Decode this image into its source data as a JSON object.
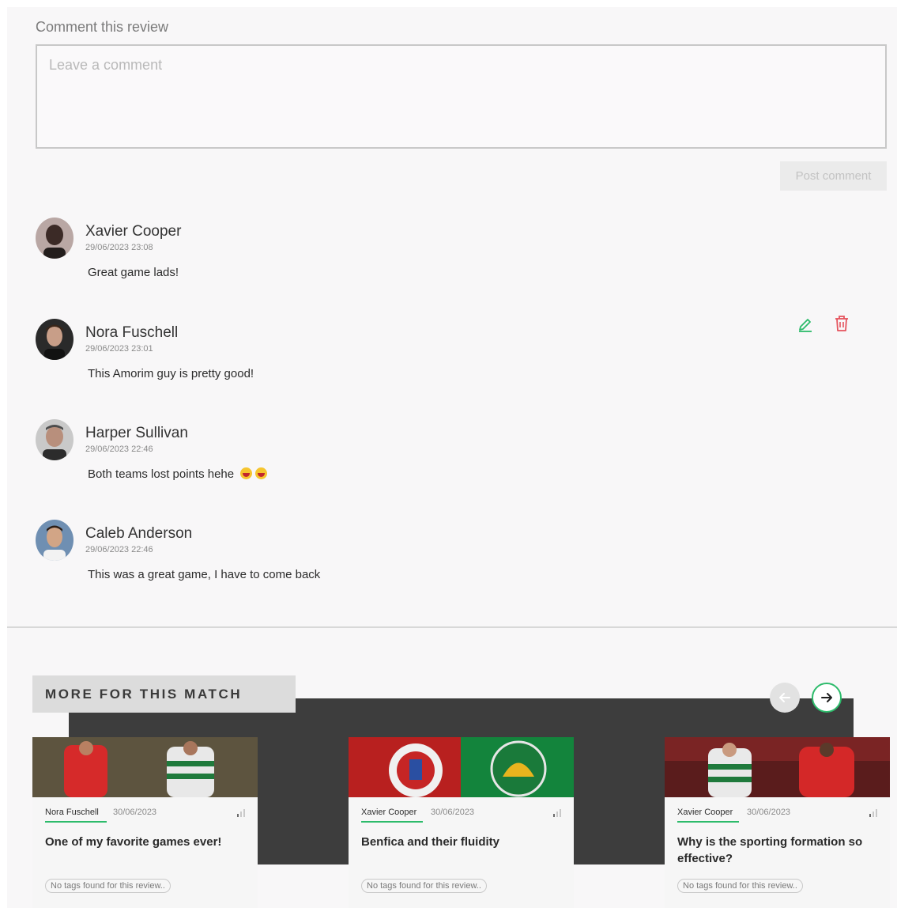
{
  "comment_form": {
    "heading": "Comment this review",
    "placeholder": "Leave a comment",
    "post_label": "Post comment"
  },
  "comments": [
    {
      "name": "Xavier Cooper",
      "date": "29/06/2023 23:08",
      "text": "Great game lads!"
    },
    {
      "name": "Nora Fuschell",
      "date": "29/06/2023 23:01",
      "text": "This Amorim guy is pretty good!"
    },
    {
      "name": "Harper Sullivan",
      "date": "29/06/2023 22:46",
      "text": "Both teams lost points hehe"
    },
    {
      "name": "Caleb Anderson",
      "date": "29/06/2023 22:46",
      "text": "This was a great game, I have to come back"
    }
  ],
  "more": {
    "title": "MORE FOR THIS MATCH",
    "cards": [
      {
        "author": "Nora Fuschell",
        "date": "30/06/2023",
        "title": "One of my favorite games ever!",
        "tag": "No tags found for this review.."
      },
      {
        "author": "Xavier Cooper",
        "date": "30/06/2023",
        "title": "Benfica and their fluidity",
        "tag": "No tags found for this review.."
      },
      {
        "author": "Xavier Cooper",
        "date": "30/06/2023",
        "title": "Why is the sporting formation so effective?",
        "tag": "No tags found for this review.."
      }
    ]
  },
  "colors": {
    "accent_green": "#2dbb6b",
    "delete_red": "#e5535d",
    "dark_band": "#3d3d3d"
  },
  "icons": [
    "edit-icon",
    "trash-icon",
    "arrow-left-icon",
    "arrow-right-icon",
    "signal-bars-icon",
    "emoji-icon"
  ]
}
